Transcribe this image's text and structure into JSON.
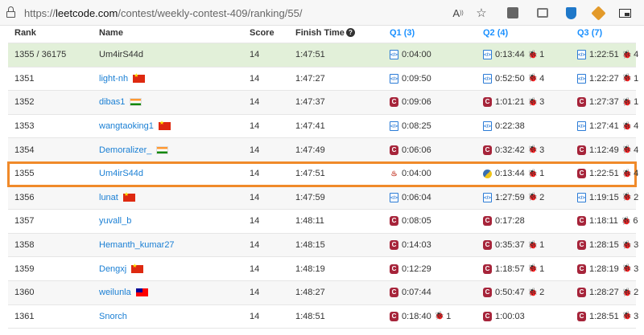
{
  "browser": {
    "url_prefix": "https://",
    "url_host": "leetcode.com",
    "url_path": "/contest/weekly-contest-409/ranking/55/",
    "toolbar_icons": [
      "read-aloud-icon",
      "favorite-star-icon",
      "extension-icon",
      "extension-icon",
      "shield-extension-icon",
      "extension-icon",
      "split-screen-icon"
    ]
  },
  "table": {
    "headers": {
      "rank": "Rank",
      "name": "Name",
      "score": "Score",
      "finish_time": "Finish Time",
      "q1": "Q1 (3)",
      "q2": "Q2 (4)",
      "q3": "Q3 (7)"
    },
    "rows": [
      {
        "rank": "1355 / 36175",
        "name": "Um4irS44d",
        "flag": "",
        "score": "14",
        "time": "1:47:51",
        "q1": {
          "lang": "file",
          "time": "0:04:00",
          "bugs": ""
        },
        "q2": {
          "lang": "file",
          "time": "0:13:44",
          "bugs": "1"
        },
        "q3": {
          "lang": "file",
          "time": "1:22:51",
          "bugs": "4"
        }
      },
      {
        "rank": "1351",
        "name": "light-nh",
        "flag": "cn",
        "score": "14",
        "time": "1:47:27",
        "q1": {
          "lang": "file",
          "time": "0:09:50",
          "bugs": ""
        },
        "q2": {
          "lang": "file",
          "time": "0:52:50",
          "bugs": "4"
        },
        "q3": {
          "lang": "file",
          "time": "1:22:27",
          "bugs": "1"
        }
      },
      {
        "rank": "1352",
        "name": "dibas1",
        "flag": "in",
        "score": "14",
        "time": "1:47:37",
        "q1": {
          "lang": "c",
          "time": "0:09:06",
          "bugs": ""
        },
        "q2": {
          "lang": "c",
          "time": "1:01:21",
          "bugs": "3"
        },
        "q3": {
          "lang": "c",
          "time": "1:27:37",
          "bugs": "1"
        }
      },
      {
        "rank": "1353",
        "name": "wangtaoking1",
        "flag": "cn",
        "score": "14",
        "time": "1:47:41",
        "q1": {
          "lang": "file",
          "time": "0:08:25",
          "bugs": ""
        },
        "q2": {
          "lang": "file",
          "time": "0:22:38",
          "bugs": ""
        },
        "q3": {
          "lang": "file",
          "time": "1:27:41",
          "bugs": "4"
        }
      },
      {
        "rank": "1354",
        "name": "Demoralizer_",
        "flag": "in",
        "score": "14",
        "time": "1:47:49",
        "q1": {
          "lang": "c",
          "time": "0:06:06",
          "bugs": ""
        },
        "q2": {
          "lang": "c",
          "time": "0:32:42",
          "bugs": "3"
        },
        "q3": {
          "lang": "c",
          "time": "1:12:49",
          "bugs": "4"
        }
      },
      {
        "rank": "1355",
        "name": "Um4irS44d",
        "flag": "",
        "score": "14",
        "time": "1:47:51",
        "q1": {
          "lang": "java",
          "time": "0:04:00",
          "bugs": ""
        },
        "q2": {
          "lang": "py",
          "time": "0:13:44",
          "bugs": "1"
        },
        "q3": {
          "lang": "c",
          "time": "1:22:51",
          "bugs": "4"
        }
      },
      {
        "rank": "1356",
        "name": "lunat",
        "flag": "cn",
        "score": "14",
        "time": "1:47:59",
        "q1": {
          "lang": "file",
          "time": "0:06:04",
          "bugs": ""
        },
        "q2": {
          "lang": "file",
          "time": "1:27:59",
          "bugs": "2"
        },
        "q3": {
          "lang": "file",
          "time": "1:19:15",
          "bugs": "2"
        }
      },
      {
        "rank": "1357",
        "name": "yuvall_b",
        "flag": "",
        "score": "14",
        "time": "1:48:11",
        "q1": {
          "lang": "c",
          "time": "0:08:05",
          "bugs": ""
        },
        "q2": {
          "lang": "c",
          "time": "0:17:28",
          "bugs": ""
        },
        "q3": {
          "lang": "c",
          "time": "1:18:11",
          "bugs": "6"
        }
      },
      {
        "rank": "1358",
        "name": "Hemanth_kumar27",
        "flag": "",
        "score": "14",
        "time": "1:48:15",
        "q1": {
          "lang": "c",
          "time": "0:14:03",
          "bugs": ""
        },
        "q2": {
          "lang": "c",
          "time": "0:35:37",
          "bugs": "1"
        },
        "q3": {
          "lang": "c",
          "time": "1:28:15",
          "bugs": "3"
        }
      },
      {
        "rank": "1359",
        "name": "Dengxj",
        "flag": "cn",
        "score": "14",
        "time": "1:48:19",
        "q1": {
          "lang": "c",
          "time": "0:12:29",
          "bugs": ""
        },
        "q2": {
          "lang": "c",
          "time": "1:18:57",
          "bugs": "1"
        },
        "q3": {
          "lang": "c",
          "time": "1:28:19",
          "bugs": "3"
        }
      },
      {
        "rank": "1360",
        "name": "weilunla",
        "flag": "tw",
        "score": "14",
        "time": "1:48:27",
        "q1": {
          "lang": "c",
          "time": "0:07:44",
          "bugs": ""
        },
        "q2": {
          "lang": "c",
          "time": "0:50:47",
          "bugs": "2"
        },
        "q3": {
          "lang": "c",
          "time": "1:28:27",
          "bugs": "2"
        }
      },
      {
        "rank": "1361",
        "name": "Snorch",
        "flag": "",
        "score": "14",
        "time": "1:48:51",
        "q1": {
          "lang": "c",
          "time": "0:18:40",
          "bugs": "1"
        },
        "q2": {
          "lang": "c",
          "time": "1:00:03",
          "bugs": ""
        },
        "q3": {
          "lang": "c",
          "time": "1:28:51",
          "bugs": "3"
        }
      }
    ],
    "highlight_row_index": 5,
    "colors": {
      "accent": "#1a90ff",
      "highlight_outline": "#f08a2a",
      "own_row_bg": "#e2f0d9",
      "bug_red": "#c5303e"
    }
  }
}
